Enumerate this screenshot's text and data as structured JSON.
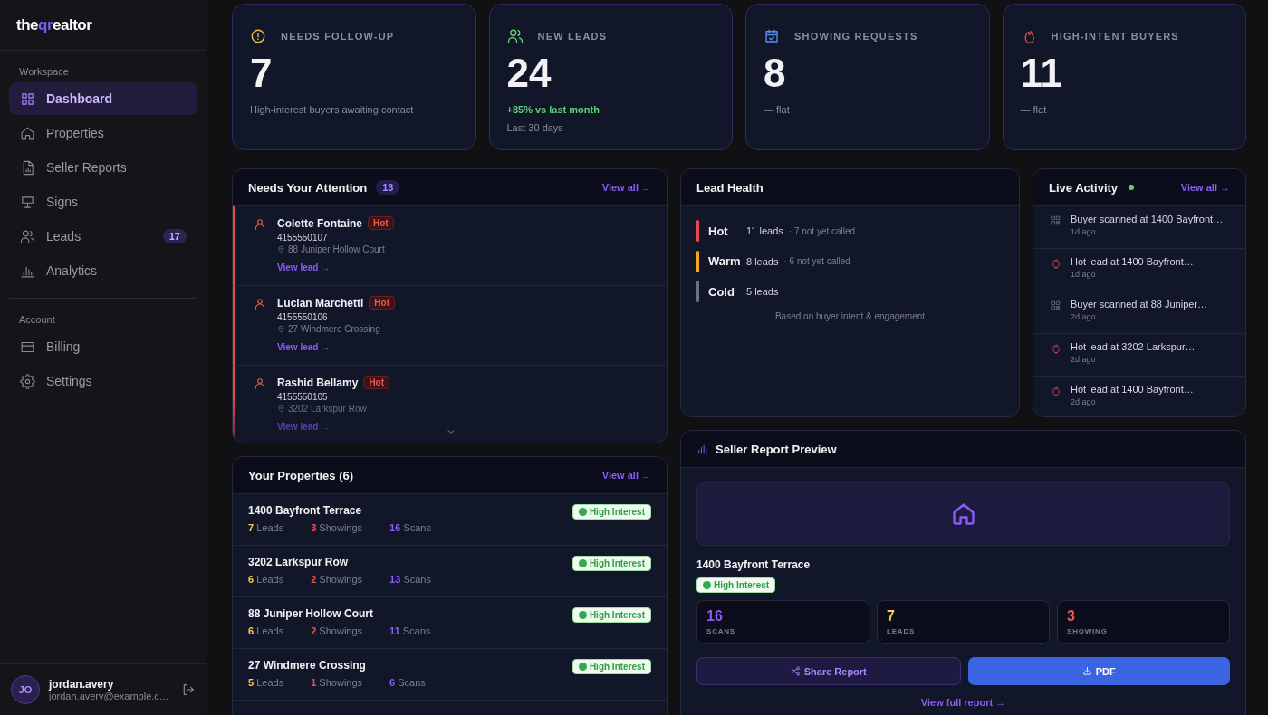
{
  "sidebar": {
    "logo": {
      "start": "the",
      "highlight": "qr",
      "end": "ealtor"
    },
    "sections": [
      {
        "label": "Workspace",
        "items": [
          {
            "kind": "grid",
            "label": "Dashboard",
            "selected": true
          },
          {
            "kind": "home",
            "label": "Properties",
            "selected": false
          },
          {
            "kind": "report",
            "label": "Seller Reports",
            "selected": false
          },
          {
            "kind": "sign",
            "label": "Signs",
            "selected": false
          },
          {
            "kind": "users",
            "label": "Leads",
            "selected": false,
            "badge": "17"
          },
          {
            "kind": "chart",
            "label": "Analytics",
            "selected": false
          }
        ]
      },
      {
        "label": "Account",
        "items": [
          {
            "kind": "card",
            "label": "Billing",
            "selected": false
          },
          {
            "kind": "gear",
            "label": "Settings",
            "selected": false
          }
        ]
      }
    ],
    "user": {
      "initials": "JO",
      "name": "jordan.avery",
      "email": "jordan.avery@example.c…"
    }
  },
  "stats": [
    {
      "kind": "alert",
      "label": "NEEDS FOLLOW-UP",
      "value": "7",
      "note": "High-interest buyers awaiting contact"
    },
    {
      "kind": "users",
      "label": "NEW LEADS",
      "value": "24",
      "trend": {
        "kind": "up",
        "text": "+85% vs last month"
      },
      "note": "Last 30 days"
    },
    {
      "kind": "calendar",
      "label": "SHOWING REQUESTS",
      "value": "8",
      "trend": {
        "kind": "flat",
        "text": "— flat"
      }
    },
    {
      "kind": "fire",
      "label": "HIGH-INTENT BUYERS",
      "value": "11",
      "trend": {
        "kind": "flat",
        "text": "— flat"
      }
    }
  ],
  "attention": {
    "title": "Needs Your Attention",
    "count": "13",
    "view_all": "View all →",
    "items": [
      {
        "name": "Colette Fontaine",
        "tag": "Hot",
        "phone": "4155550107",
        "address": "88 Juniper Hollow Court",
        "link": "View lead →"
      },
      {
        "name": "Lucian Marchetti",
        "tag": "Hot",
        "phone": "4155550106",
        "address": "27 Windmere Crossing",
        "link": "View lead →"
      },
      {
        "name": "Rashid Bellamy",
        "tag": "Hot",
        "phone": "4155550105",
        "address": "3202 Larkspur Row",
        "link": "View lead →"
      }
    ]
  },
  "properties": {
    "title": "Your Properties (6)",
    "view_all": "View all →",
    "rows": [
      {
        "name": "1400 Bayfront Terrace",
        "badge": "High Interest",
        "stats": [
          {
            "value": "7",
            "label": "Leads"
          },
          {
            "value": "3",
            "label": "Showings"
          },
          {
            "value": "16",
            "label": "Scans"
          }
        ]
      },
      {
        "name": "3202 Larkspur Row",
        "badge": "High Interest",
        "stats": [
          {
            "value": "6",
            "label": "Leads"
          },
          {
            "value": "2",
            "label": "Showings"
          },
          {
            "value": "13",
            "label": "Scans"
          }
        ]
      },
      {
        "name": "88 Juniper Hollow Court",
        "badge": "High Interest",
        "stats": [
          {
            "value": "6",
            "label": "Leads"
          },
          {
            "value": "2",
            "label": "Showings"
          },
          {
            "value": "11",
            "label": "Scans"
          }
        ]
      },
      {
        "name": "27 Windmere Crossing",
        "badge": "High Interest",
        "stats": [
          {
            "value": "5",
            "label": "Leads"
          },
          {
            "value": "1",
            "label": "Showings"
          },
          {
            "value": "6",
            "label": "Scans"
          }
        ]
      }
    ]
  },
  "lead_health": {
    "title": "Lead Health",
    "rows": [
      {
        "label": "Hot",
        "color": "#e5484d",
        "count": "11 leads",
        "note": "· 7 not yet called"
      },
      {
        "label": "Warm",
        "color": "#f5a524",
        "count": "8 leads",
        "note": "· 6 not yet called"
      },
      {
        "label": "Cold",
        "color": "#6b7280",
        "count": "5 leads"
      }
    ],
    "footnote": "Based on buyer intent & engagement"
  },
  "live_activity": {
    "title": "Live Activity",
    "live": true,
    "view_all": "View all →",
    "items": [
      {
        "kind": "qr",
        "text": "Buyer scanned at 1400 Bayfront…",
        "time": "1d ago"
      },
      {
        "kind": "fire",
        "text": "Hot lead at 1400 Bayfront…",
        "time": "1d ago"
      },
      {
        "kind": "qr",
        "text": "Buyer scanned at 88 Juniper…",
        "time": "2d ago"
      },
      {
        "kind": "fire",
        "text": "Hot lead at 3202 Larkspur…",
        "time": "2d ago"
      },
      {
        "kind": "fire",
        "text": "Hot lead at 1400 Bayfront…",
        "time": "2d ago"
      }
    ]
  },
  "seller_report": {
    "title": "Seller Report Preview",
    "property": "1400 Bayfront Terrace",
    "badge": "High Interest",
    "metrics": [
      {
        "value": "16",
        "label": "SCANS",
        "color": "#8b5cf6"
      },
      {
        "value": "7",
        "label": "LEADS",
        "color": "#facc55"
      },
      {
        "value": "3",
        "label": "SHOWING",
        "color": "#ef5350"
      }
    ],
    "share_button": "Share Report",
    "pdf_button": "PDF",
    "link": "View full report →"
  }
}
